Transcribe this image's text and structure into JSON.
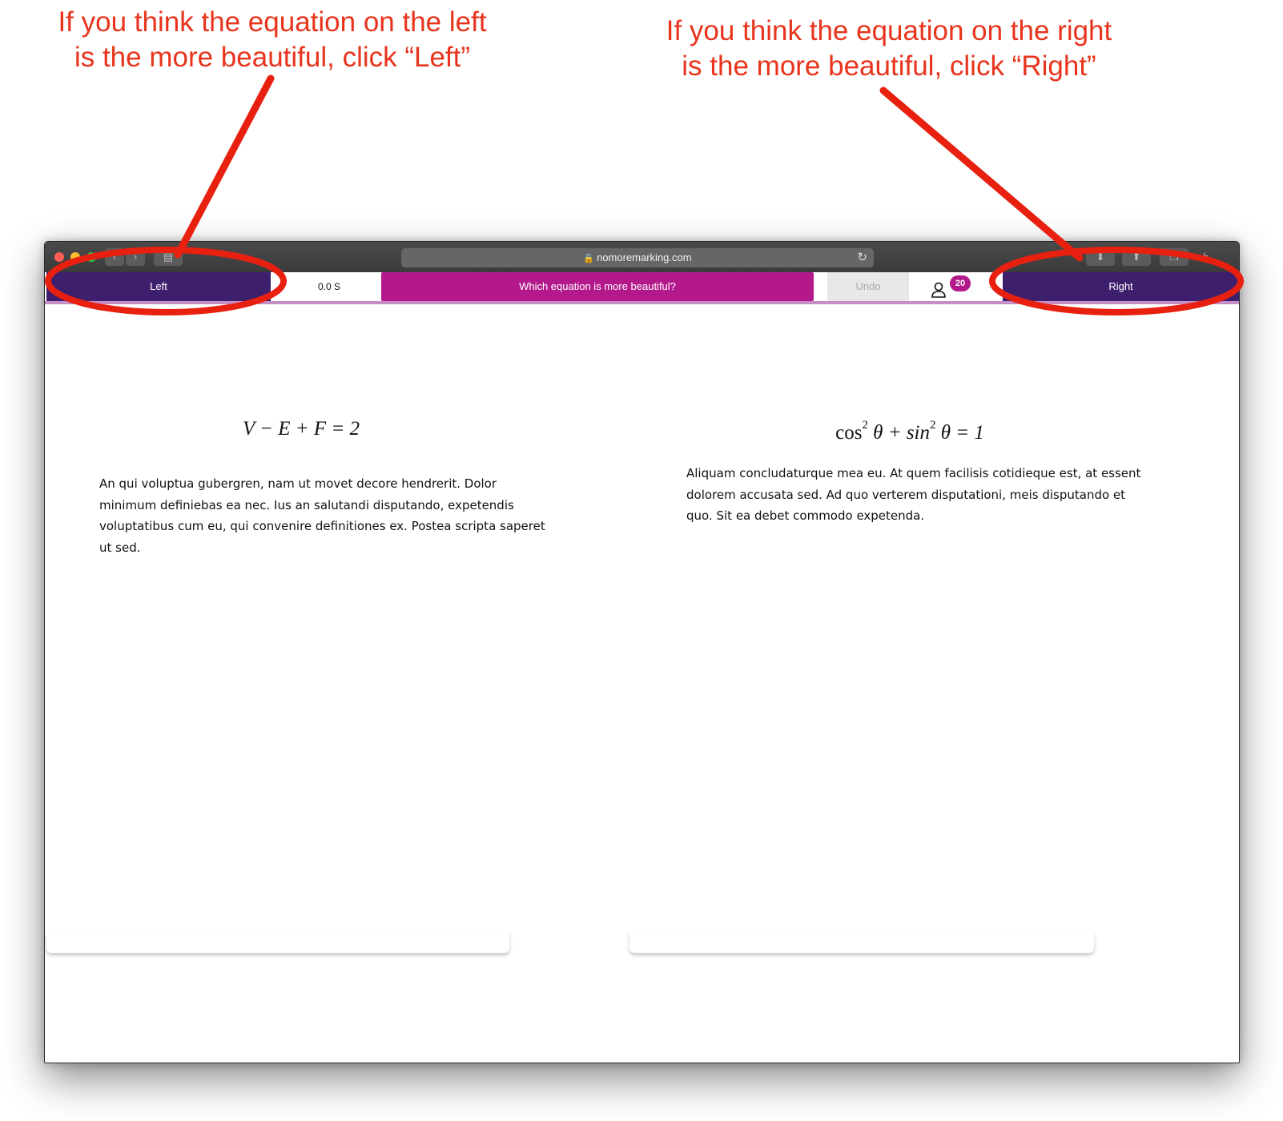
{
  "annotations": {
    "left_callout": [
      "If you think the equation on the left",
      "is the more beautiful, click “Left”"
    ],
    "right_callout": [
      "If you think the equation on the right",
      "is the more beautiful, click “Right”"
    ]
  },
  "browser": {
    "url": "nomoremarking.com"
  },
  "toolbar": {
    "left_label": "Left",
    "timer": "0.0 S",
    "question": "Which equation is more beautiful?",
    "undo_label": "Undo",
    "user_count": "20",
    "right_label": "Right"
  },
  "left_panel": {
    "equation": "V − E + F = 2",
    "text": "An qui voluptua gubergren, nam ut movet decore hendrerit. Dolor minimum definiebas ea nec. Ius an salutandi disputando, expetendis voluptatibus cum eu, qui convenire definitiones ex. Postea scripta saperet ut sed."
  },
  "right_panel": {
    "equation_parts": [
      "cos",
      "2",
      " θ + sin",
      "2",
      " θ = 1"
    ],
    "text": "Aliquam concludaturque mea eu. At quem facilisis cotidieque est, at essent dolorem accusata sed. Ad quo verterem disputationi, meis disputando et quo. Sit ea debet commodo expetenda."
  },
  "colors": {
    "choice_button": "#3e1f6e",
    "question_bar": "#b3198b",
    "annotation": "#e8341c"
  }
}
